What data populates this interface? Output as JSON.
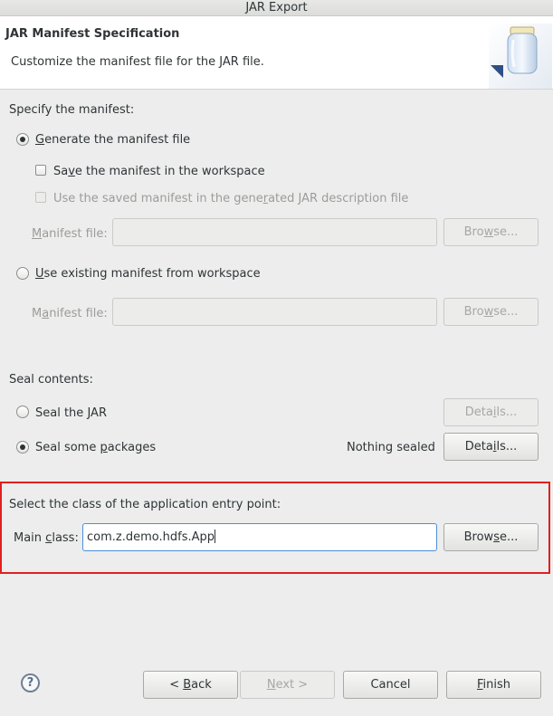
{
  "window": {
    "title": "JAR Export"
  },
  "header": {
    "title": "JAR Manifest Specification",
    "subtitle": "Customize the manifest file for the JAR file."
  },
  "manifest": {
    "section_label": "Specify the manifest:",
    "generate": {
      "pre": "",
      "mn": "G",
      "post": "enerate the manifest file",
      "checked": true
    },
    "save_in_workspace": {
      "pre": "Sa",
      "mn": "v",
      "post": "e the manifest in the workspace",
      "checked": false
    },
    "use_saved": {
      "pre": "Use the saved manifest in the gene",
      "mn": "r",
      "post": "ated JAR description file",
      "checked": false,
      "enabled": false
    },
    "manifest_file_1": {
      "pre": "",
      "mn": "M",
      "post": "anifest file:",
      "value": "",
      "browse": {
        "pre": "Bro",
        "mn": "w",
        "post": "se..."
      }
    },
    "use_existing": {
      "pre": "",
      "mn": "U",
      "post": "se existing manifest from workspace",
      "checked": false
    },
    "manifest_file_2": {
      "pre": "M",
      "mn": "a",
      "post": "nifest file:",
      "value": "",
      "browse": {
        "pre": "Bro",
        "mn": "w",
        "post": "se..."
      }
    }
  },
  "seal": {
    "section_label": "Seal contents:",
    "seal_jar": {
      "pre": "Seal the ",
      "mn": "J",
      "post": "AR",
      "checked": false,
      "details": {
        "pre": "Deta",
        "mn": "i",
        "post": "ls..."
      }
    },
    "seal_some": {
      "pre": "Seal some ",
      "mn": "p",
      "post": "ackages",
      "checked": true,
      "status": "Nothing sealed",
      "details": {
        "pre": "Deta",
        "mn": "i",
        "post": "ls..."
      }
    }
  },
  "entry_point": {
    "section_label": "Select the class of the application entry point:",
    "main_class": {
      "pre": "Main ",
      "mn": "c",
      "post": "lass:",
      "value": "com.z.demo.hdfs.App",
      "browse": {
        "pre": "Brow",
        "mn": "s",
        "post": "e..."
      }
    }
  },
  "footer": {
    "help_glyph": "?",
    "back": {
      "pre": "< ",
      "mn": "B",
      "post": "ack"
    },
    "next": {
      "pre": "",
      "mn": "N",
      "post": "ext >"
    },
    "cancel": "Cancel",
    "finish": {
      "pre": "",
      "mn": "F",
      "post": "inish"
    }
  },
  "colors": {
    "highlight": "#e02020",
    "focus": "#4a90d9"
  }
}
